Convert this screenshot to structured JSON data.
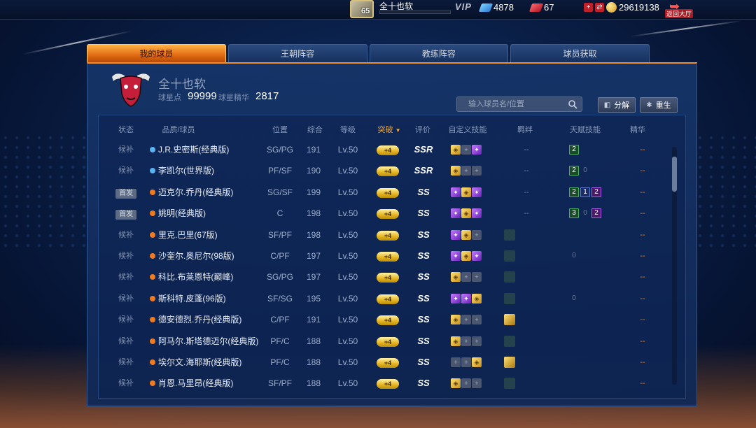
{
  "topbar": {
    "avatar_level": "65",
    "player_name": "全十也软",
    "vip_label": "VIP",
    "diamonds": "4878",
    "tickets": "67",
    "coins": "29619138",
    "back_label": "返回大厅"
  },
  "tabs": [
    {
      "label": "我的球员",
      "active": true
    },
    {
      "label": "王朝阵容",
      "active": false
    },
    {
      "label": "教练阵容",
      "active": false
    },
    {
      "label": "球员获取",
      "active": false
    }
  ],
  "team": {
    "name": "全十也软",
    "points_label": "球星点",
    "points_value": "99999",
    "essence_label": "球星精华",
    "essence_value": "2817"
  },
  "search": {
    "placeholder": "输入球员名/位置"
  },
  "buttons": {
    "decompose": "分解",
    "rebirth": "重生"
  },
  "table": {
    "headers": {
      "status": "状态",
      "player": "品质/球员",
      "position": "位置",
      "overall": "综合",
      "level": "等级",
      "breakthrough": "突破",
      "grade": "评价",
      "skills": "自定义技能",
      "bonds": "羁绊",
      "talents": "天赋技能",
      "essence": "精华"
    },
    "rows": [
      {
        "status": "候补",
        "starter": false,
        "quality": "blue",
        "name": "J.R.史密斯(经典版)",
        "position": "SG/PG",
        "overall": "191",
        "level": "Lv.50",
        "breakthrough": "+4",
        "grade": "SSR",
        "skills": [
          "gold",
          "empty",
          "purple"
        ],
        "bond": "--",
        "talents": [
          {
            "v": "2",
            "c": "green"
          }
        ],
        "essence": "--"
      },
      {
        "status": "候补",
        "starter": false,
        "quality": "blue",
        "name": "李凯尔(世界版)",
        "position": "PF/SF",
        "overall": "190",
        "level": "Lv.50",
        "breakthrough": "+4",
        "grade": "SSR",
        "skills": [
          "gold",
          "empty",
          "empty"
        ],
        "bond": "--",
        "talents": [
          {
            "v": "2",
            "c": "green"
          },
          {
            "v": "0",
            "c": "gray"
          }
        ],
        "essence": "--"
      },
      {
        "status": "首发",
        "starter": true,
        "quality": "orange",
        "name": "迈克尔.乔丹(经典版)",
        "position": "SG/SF",
        "overall": "199",
        "level": "Lv.50",
        "breakthrough": "+4",
        "grade": "SS",
        "skills": [
          "purple",
          "gold",
          "purple"
        ],
        "bond": "--",
        "talents": [
          {
            "v": "2",
            "c": "green"
          },
          {
            "v": "1",
            "c": "blue"
          },
          {
            "v": "2",
            "c": "purple"
          }
        ],
        "essence": "--"
      },
      {
        "status": "首发",
        "starter": true,
        "quality": "orange",
        "name": "姚明(经典版)",
        "position": "C",
        "overall": "198",
        "level": "Lv.50",
        "breakthrough": "+4",
        "grade": "SS",
        "skills": [
          "purple",
          "gold",
          "purple"
        ],
        "bond": "--",
        "talents": [
          {
            "v": "3",
            "c": "green"
          },
          {
            "v": "0",
            "c": "gray"
          },
          {
            "v": "2",
            "c": "purple"
          }
        ],
        "essence": "--"
      },
      {
        "status": "候补",
        "starter": false,
        "quality": "orange",
        "name": "里克.巴里(67版)",
        "position": "SF/PF",
        "overall": "198",
        "level": "Lv.50",
        "breakthrough": "+4",
        "grade": "SS",
        "skills": [
          "purple",
          "gold",
          "empty"
        ],
        "bond": "dim",
        "talents": [],
        "essence": "--"
      },
      {
        "status": "候补",
        "starter": false,
        "quality": "orange",
        "name": "沙奎尔.奥尼尔(98版)",
        "position": "C/PF",
        "overall": "197",
        "level": "Lv.50",
        "breakthrough": "+4",
        "grade": "SS",
        "skills": [
          "purple",
          "gold",
          "purple"
        ],
        "bond": "dim",
        "talents": [
          {
            "v": "0",
            "c": "gray"
          }
        ],
        "essence": "--"
      },
      {
        "status": "候补",
        "starter": false,
        "quality": "orange",
        "name": "科比.布莱恩特(巅峰)",
        "position": "SG/PG",
        "overall": "197",
        "level": "Lv.50",
        "breakthrough": "+4",
        "grade": "SS",
        "skills": [
          "gold",
          "empty",
          "empty"
        ],
        "bond": "dim",
        "talents": [],
        "essence": "--"
      },
      {
        "status": "候补",
        "starter": false,
        "quality": "orange",
        "name": "斯科特.皮蓬(96版)",
        "position": "SF/SG",
        "overall": "195",
        "level": "Lv.50",
        "breakthrough": "+4",
        "grade": "SS",
        "skills": [
          "purple",
          "purple",
          "gold"
        ],
        "bond": "dim",
        "talents": [
          {
            "v": "0",
            "c": "gray"
          }
        ],
        "essence": "--"
      },
      {
        "status": "候补",
        "starter": false,
        "quality": "orange",
        "name": "德安德烈.乔丹(经典版)",
        "position": "C/PF",
        "overall": "191",
        "level": "Lv.50",
        "breakthrough": "+4",
        "grade": "SS",
        "skills": [
          "gold",
          "empty",
          "empty"
        ],
        "bond": "gold",
        "talents": [],
        "essence": "--"
      },
      {
        "status": "候补",
        "starter": false,
        "quality": "orange",
        "name": "阿马尔.斯塔德迈尔(经典版)",
        "position": "PF/C",
        "overall": "188",
        "level": "Lv.50",
        "breakthrough": "+4",
        "grade": "SS",
        "skills": [
          "gold",
          "empty",
          "empty"
        ],
        "bond": "dim",
        "talents": [],
        "essence": "--"
      },
      {
        "status": "候补",
        "starter": false,
        "quality": "orange",
        "name": "埃尔文.海耶斯(经典版)",
        "position": "PF/C",
        "overall": "188",
        "level": "Lv.50",
        "breakthrough": "+4",
        "grade": "SS",
        "skills": [
          "empty",
          "empty",
          "gold"
        ],
        "bond": "gold",
        "talents": [],
        "essence": "--"
      },
      {
        "status": "候补",
        "starter": false,
        "quality": "orange",
        "name": "肖恩.马里昂(经典版)",
        "position": "SF/PF",
        "overall": "188",
        "level": "Lv.50",
        "breakthrough": "+4",
        "grade": "SS",
        "skills": [
          "gold",
          "empty",
          "empty"
        ],
        "bond": "dim",
        "talents": [],
        "essence": "--"
      }
    ]
  },
  "colors": {
    "tab_active": "#e26b12",
    "quality_blue": "#5ab4f0",
    "quality_orange": "#f07a1e",
    "breakthrough_gold": "#e4b420"
  }
}
